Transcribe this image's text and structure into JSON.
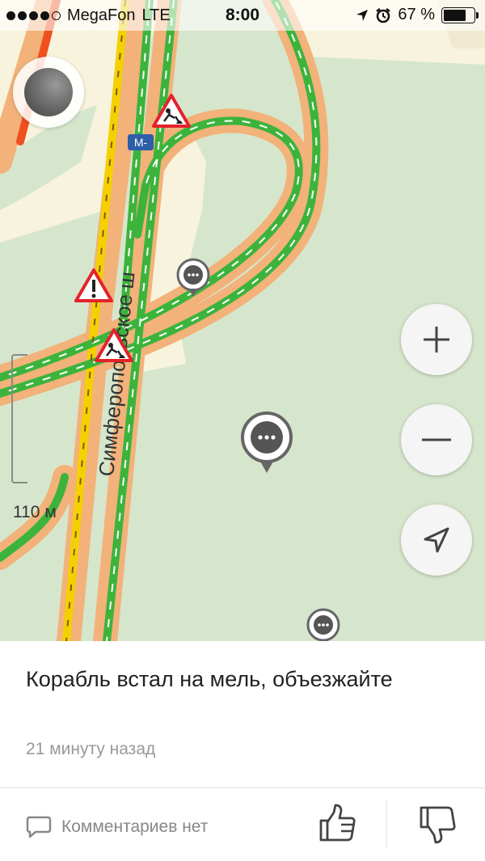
{
  "status_bar": {
    "carrier": "MegaFon",
    "network": "LTE",
    "time": "8:00",
    "battery_percent": "67 %",
    "battery_level": 0.67,
    "signal_bars": 4
  },
  "map": {
    "road_label": "Симферопольское ш",
    "highway_badge": "M-",
    "scale_label": "110 м",
    "colors": {
      "free_traffic": "#3cb43c",
      "slow_traffic": "#f5d000",
      "heavy_traffic": "#f05020",
      "road_casing": "#f2b27a",
      "land": "#d6e6cc",
      "urban": "#f7f3dc"
    },
    "icons": [
      "profile-icon",
      "zoom-in-icon",
      "zoom-out-icon",
      "locate-arrow-icon",
      "roadworks-warning-icon",
      "danger-warning-icon",
      "chat-pin-icon"
    ]
  },
  "event": {
    "message": "Корабль встал на мель, объезжайте",
    "time_ago": "21 минуту назад",
    "comments_label": "Комментариев нет"
  }
}
